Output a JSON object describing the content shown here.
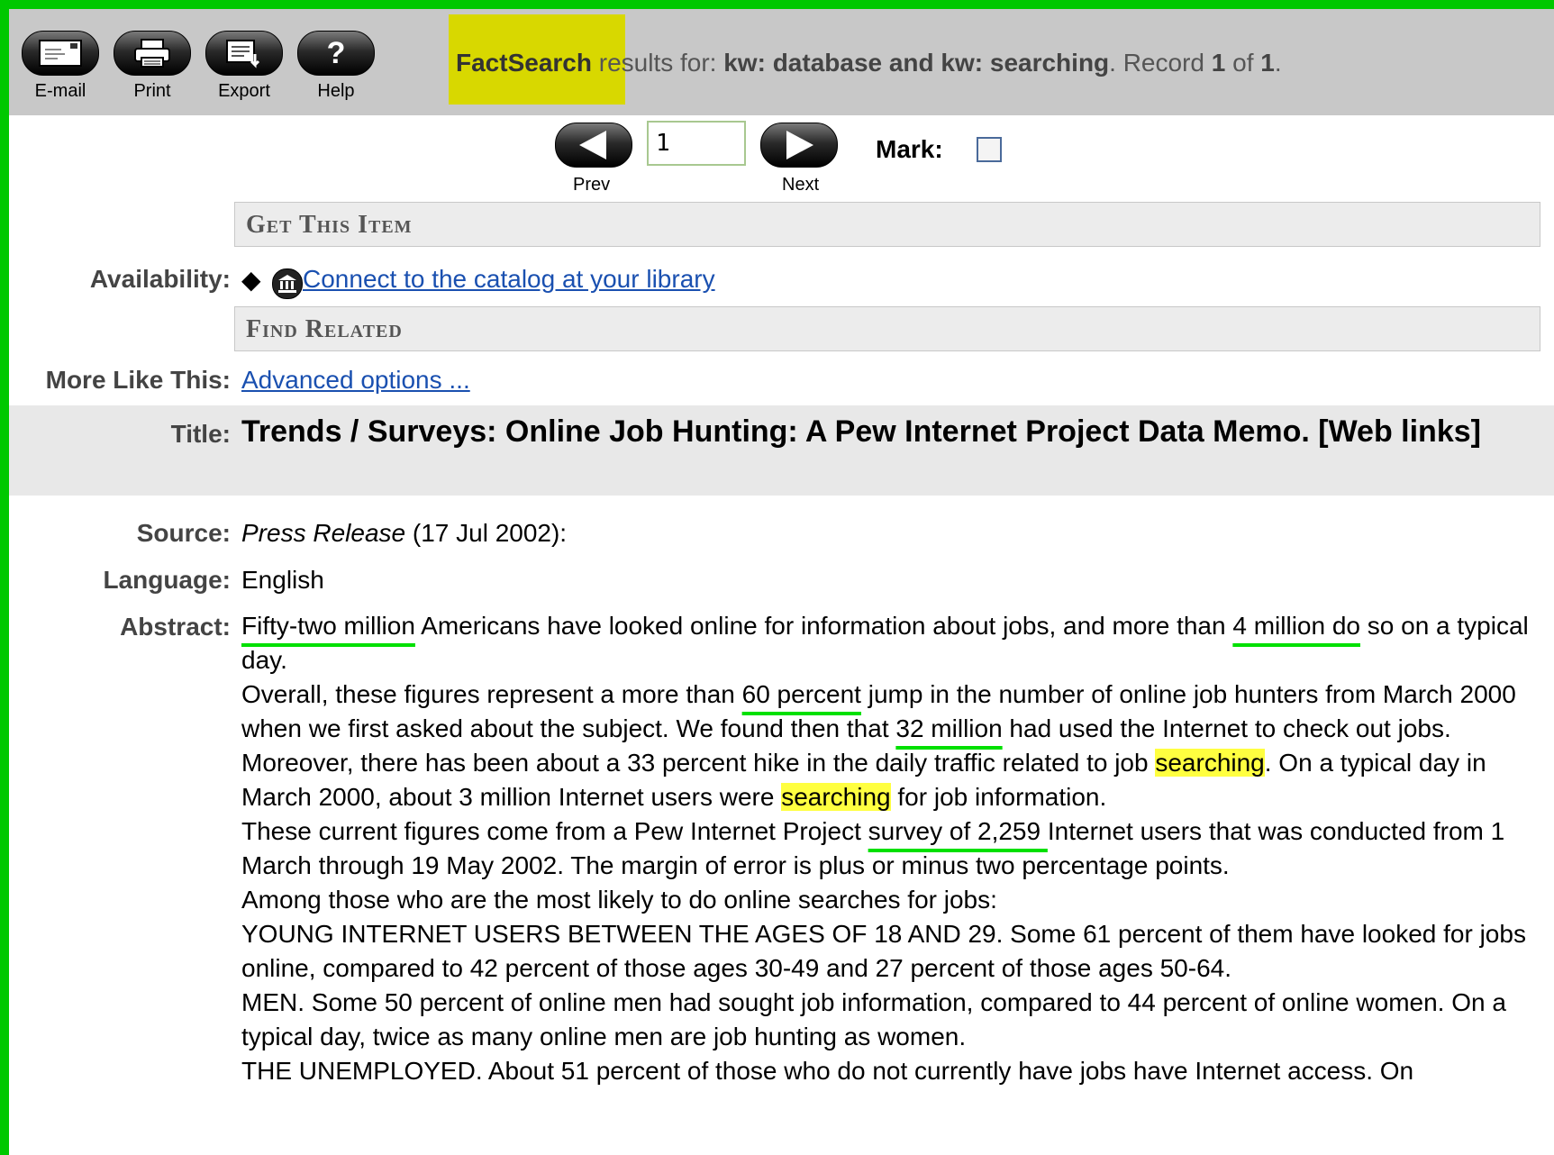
{
  "toolbar": {
    "email_label": "E-mail",
    "print_label": "Print",
    "export_label": "Export",
    "help_label": "Help",
    "help_glyph": "?"
  },
  "header": {
    "brand": "FactSearch",
    "results_for": " results for: ",
    "query": "kw: database and kw: searching",
    "record_prefix": ". Record ",
    "record_num": "1",
    "of": " of ",
    "record_total": "1",
    "end": "."
  },
  "nav": {
    "prev_label": "Prev",
    "next_label": "Next",
    "record_input_value": "1",
    "mark_label": "Mark:"
  },
  "sections": {
    "get_this_item": "Get This Item",
    "find_related": "Find Related"
  },
  "record": {
    "availability_label": "Availability:",
    "availability_link": " Connect to the catalog at your library",
    "more_like_label": "More Like This:",
    "more_like_link": "Advanced options ...",
    "title_label": "Title:",
    "title": "Trends / Surveys: Online Job Hunting: A Pew Internet Project Data Memo. [Web links]",
    "source_label": "Source:",
    "source_pub": "Press Release",
    "source_date": " (17 Jul 2002):",
    "language_label": "Language:",
    "language": "English",
    "abstract_label": "Abstract:",
    "abstract": {
      "p1_a": "Fifty-two million",
      "p1_b": " Americans have looked online for information about jobs, and more than ",
      "p1_c": "4 million do",
      "p1_d": " so on a typical day.",
      "p2_a": "Overall, these figures represent a more than ",
      "p2_b": "60 percent",
      "p2_c": " jump in the number of online job hunters from March 2000 when we first asked about the subject. We found then that ",
      "p2_d": "32 million",
      "p2_e": " had used the Internet to check out jobs. Moreover, there has been about a 33 percent hike in the daily traffic related to job ",
      "p2_f": "searching",
      "p2_g": ". On a typical day in March 2000, about 3 million Internet users were ",
      "p2_h": "searching",
      "p2_i": " for job information.",
      "p3_a": "These current figures come from a Pew Internet Project ",
      "p3_b": "survey of 2,259 ",
      "p3_c": "Internet users that was conducted from 1 March through 19 May 2002. The margin of error is plus or minus two percentage points.",
      "p4": "Among those who are the most likely to do online searches for jobs:",
      "p5": "YOUNG INTERNET USERS BETWEEN THE AGES OF 18 AND 29. Some 61 percent of them have looked for jobs online, compared to 42 percent of those ages 30-49 and 27 percent of those ages 50-64.",
      "p6": "MEN. Some 50 percent of online men had sought job information, compared to 44 percent of online women. On a typical day, twice as many online men are job hunting as women.",
      "p7": "THE UNEMPLOYED. About 51 percent of those who do not currently have jobs have Internet access. On"
    }
  }
}
